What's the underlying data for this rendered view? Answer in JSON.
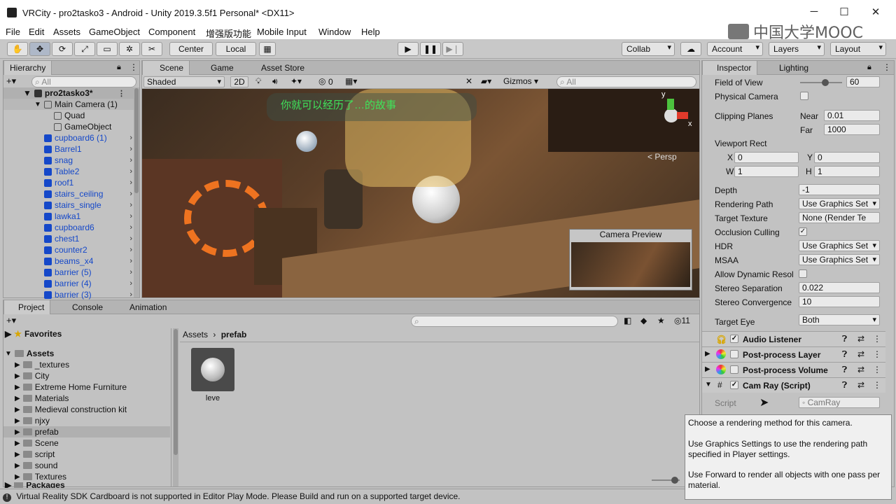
{
  "window": {
    "title": "VRCity - pro2tasko3 - Android - Unity 2019.3.5f1 Personal* <DX11>"
  },
  "watermark": "中国大学MOOC",
  "menu": [
    "File",
    "Edit",
    "Assets",
    "GameObject",
    "Component",
    "增强版功能",
    "Mobile Input",
    "Window",
    "Help"
  ],
  "toolbar": {
    "center": "Center",
    "local": "Local",
    "collab": "Collab",
    "account": "Account",
    "layers": "Layers",
    "layout": "Layout"
  },
  "hierarchy": {
    "tab": "Hierarchy",
    "search_placeholder": "All",
    "scene": "pro2tasko3*",
    "camera": "Main Camera (1)",
    "quad": "Quad",
    "gameobject": "GameObject",
    "items": [
      "cupboard6 (1)",
      "Barrel1",
      "snag",
      "Table2",
      "roof1",
      "stairs_ceiling",
      "stairs_single",
      "lawka1",
      "cupboard6",
      "chest1",
      "counter2",
      "beams_x4",
      "barrier (5)",
      "barrier (4)",
      "barrier (3)"
    ]
  },
  "scene": {
    "tabs": [
      "Scene",
      "Game",
      "Asset Store"
    ],
    "shading": "Shaded",
    "mode2d": "2D",
    "hidden_count": "0",
    "gizmos": "Gizmos",
    "search_placeholder": "All",
    "persp": "< Persp",
    "overlay_text": "你就可以经历了…的故事",
    "camera_preview": "Camera Preview",
    "axis_y": "y",
    "axis_x": "x"
  },
  "project": {
    "tabs": [
      "Project",
      "Console",
      "Animation"
    ],
    "hidden_count": "11",
    "favorites": "Favorites",
    "assets": "Assets",
    "folders": [
      "_textures",
      "City",
      "Extreme Home Furniture",
      "Materials",
      "Medieval construction kit",
      "njxy",
      "prefab",
      "Scene",
      "script",
      "sound",
      "Textures"
    ],
    "packages": "Packages",
    "breadcrumb": [
      "Assets",
      "prefab"
    ],
    "asset_name": "leve"
  },
  "inspector": {
    "tabs": [
      "Inspector",
      "Lighting"
    ],
    "fov_label": "Field of View",
    "fov": "60",
    "fov_slider_fraction": 0.6,
    "physical_camera": "Physical Camera",
    "clipping": "Clipping Planes",
    "near_label": "Near",
    "near": "0.01",
    "far_label": "Far",
    "far": "1000",
    "viewport": "Viewport Rect",
    "x_label": "X",
    "x": "0",
    "y_label": "Y",
    "y": "0",
    "w_label": "W",
    "w": "1",
    "h_label": "H",
    "h": "1",
    "depth_label": "Depth",
    "depth": "-1",
    "rendering_path_label": "Rendering Path",
    "rendering_path": "Use Graphics Set",
    "target_texture_label": "Target Texture",
    "target_texture": "None (Render Te",
    "occlusion_label": "Occlusion Culling",
    "hdr_label": "HDR",
    "hdr": "Use Graphics Set",
    "msaa_label": "MSAA",
    "msaa": "Use Graphics Set",
    "dyn_res_label": "Allow Dynamic Resol",
    "stereo_sep_label": "Stereo Separation",
    "stereo_sep": "0.022",
    "stereo_conv_label": "Stereo Convergence",
    "stereo_conv": "10",
    "target_eye_label": "Target Eye",
    "target_eye": "Both",
    "components": [
      "Audio Listener",
      "Post-process Layer",
      "Post-process Volume",
      "Cam Ray (Script)"
    ],
    "script_label": "Script",
    "script_value": "CamRay"
  },
  "tooltip": {
    "line1": "Choose a rendering method for this camera.",
    "line2": "Use Graphics Settings to use the rendering path specified in Player settings.",
    "line3": "Use Forward to render all objects with one pass per material."
  },
  "status": "Virtual Reality SDK Cardboard is not supported in Editor Play Mode. Please Build and run on a supported target device.",
  "colors": {
    "hier_blue": "#1548c9",
    "accent": "#3a72d8"
  }
}
